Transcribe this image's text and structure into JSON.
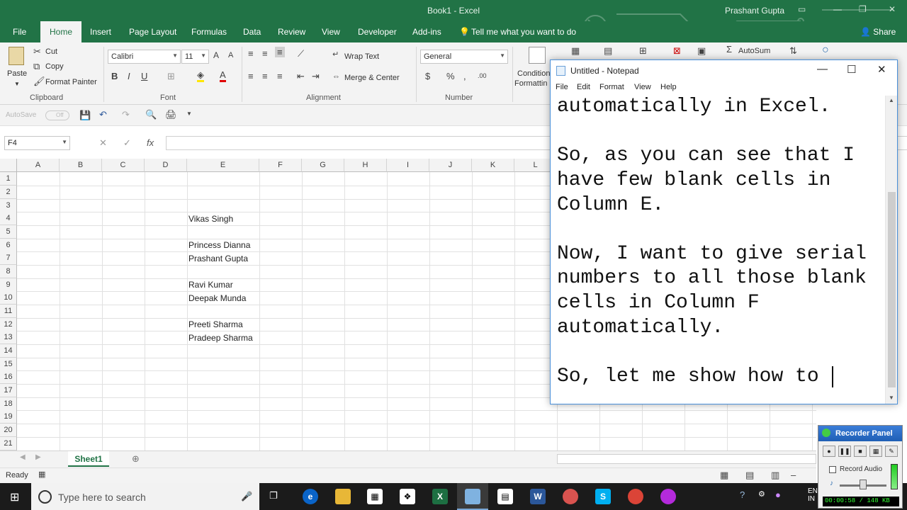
{
  "excel": {
    "title": "Book1  -  Excel",
    "user": "Prashant Gupta",
    "tabs": [
      "File",
      "Home",
      "Insert",
      "Page Layout",
      "Formulas",
      "Data",
      "Review",
      "View",
      "Developer",
      "Add-ins"
    ],
    "tell_me": "Tell me what you want to do",
    "share": "Share",
    "ribbon": {
      "clipboard": {
        "paste": "Paste",
        "cut": "Cut",
        "copy": "Copy",
        "format_painter": "Format Painter",
        "label": "Clipboard"
      },
      "font": {
        "name": "Calibri",
        "size": "11",
        "label": "Font"
      },
      "alignment": {
        "wrap_text": "Wrap Text",
        "merge_center": "Merge & Center",
        "label": "Alignment"
      },
      "number": {
        "format": "General",
        "label": "Number"
      },
      "styles": {
        "conditional": "Conditional",
        "formatting": "Formattin"
      },
      "editing": {
        "autosum": "AutoSum"
      }
    },
    "qat": {
      "autosave": "AutoSave",
      "autosave_state": "Off"
    },
    "formula_bar": {
      "name_box": "F4",
      "fx": "fx",
      "formula": ""
    },
    "columns": [
      "A",
      "B",
      "C",
      "D",
      "E",
      "F",
      "G",
      "H",
      "I",
      "J",
      "K",
      "L"
    ],
    "rows": [
      "1",
      "2",
      "3",
      "4",
      "5",
      "6",
      "7",
      "8",
      "9",
      "10",
      "11",
      "12",
      "13",
      "14",
      "15",
      "16",
      "17",
      "18",
      "19",
      "20",
      "21"
    ],
    "cells": {
      "E4": "Vikas Singh",
      "E6": "Princess Dianna",
      "E7": "Prashant Gupta",
      "E9": "Ravi Kumar",
      "E10": "Deepak Munda",
      "E12": "Preeti Sharma",
      "E13": "Pradeep Sharma"
    },
    "sheet_tab": "Sheet1",
    "status": "Ready"
  },
  "notepad": {
    "title": "Untitled - Notepad",
    "menu": [
      "File",
      "Edit",
      "Format",
      "View",
      "Help"
    ],
    "lines": [
      "automatically in Excel.",
      "",
      "So, as you can see that I",
      "have few blank cells in",
      "Column E.",
      "",
      "Now, I want to give serial",
      "numbers to all those blank",
      "cells in Column F",
      "automatically.",
      "",
      "So, let me show how to "
    ]
  },
  "taskbar": {
    "search_placeholder": "Type here to search",
    "tray": "EN IN"
  },
  "recorder": {
    "title": "Recorder Panel",
    "record_audio": "Record Audio",
    "status": "00:00:58 / 148 KB"
  },
  "colors": {
    "excel_green": "#217346",
    "notepad_border": "#4a90d9",
    "taskbar": "#1b1b1b"
  }
}
